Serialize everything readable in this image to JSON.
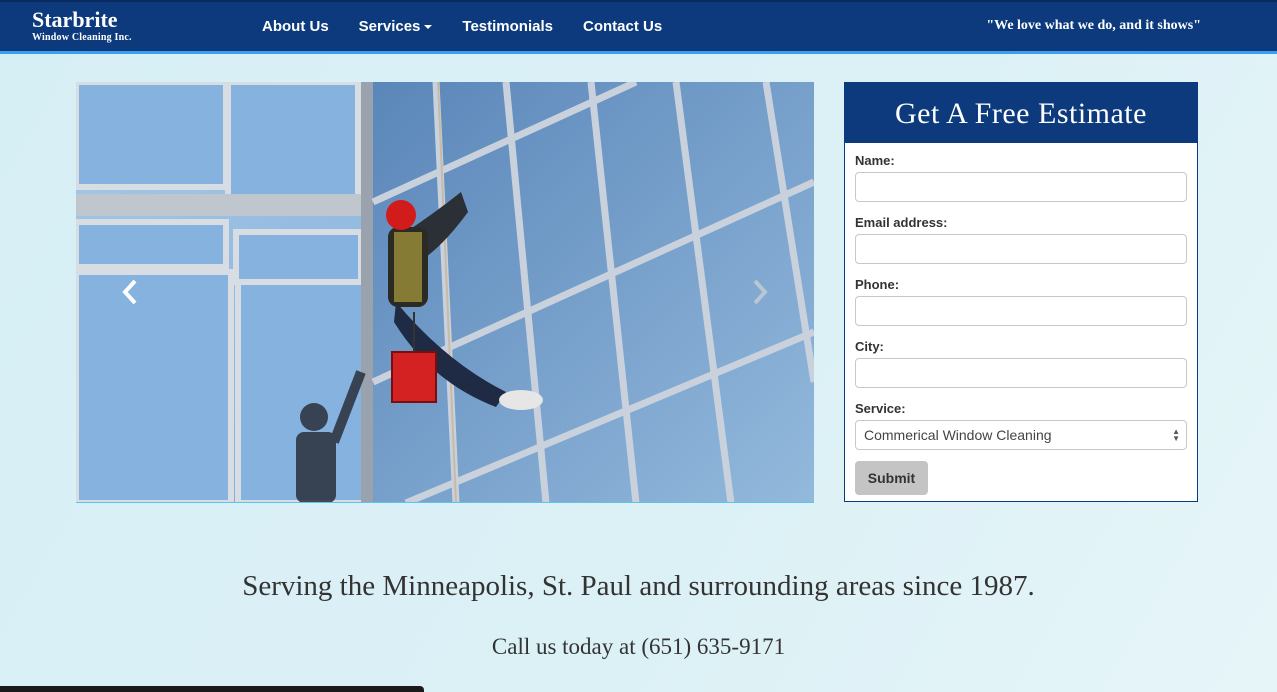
{
  "brand": {
    "name": "Starbrite",
    "subtitle": "Window Cleaning Inc."
  },
  "nav": {
    "items": [
      {
        "label": "About Us"
      },
      {
        "label": "Services"
      },
      {
        "label": "Testimonials"
      },
      {
        "label": "Contact Us"
      }
    ],
    "tagline": "\"We love what we do, and it shows\""
  },
  "carousel": {
    "prev_icon": "chevron-left-icon",
    "next_icon": "chevron-right-icon"
  },
  "estimate": {
    "title": "Get A Free Estimate",
    "fields": [
      {
        "label": "Name:",
        "value": ""
      },
      {
        "label": "Email address:",
        "value": ""
      },
      {
        "label": "Phone:",
        "value": ""
      },
      {
        "label": "City:",
        "value": ""
      }
    ],
    "service": {
      "label": "Service:",
      "selected": "Commerical Window Cleaning"
    },
    "submit_label": "Submit"
  },
  "content": {
    "serving": "Serving the Minneapolis, St. Paul and surrounding areas since 1987.",
    "call": "Call us today at (651) 635-9171"
  },
  "colors": {
    "nav_bg": "#0c3a7c",
    "nav_accent": "#3b9ff0",
    "page_bg": "#d6eff5"
  }
}
